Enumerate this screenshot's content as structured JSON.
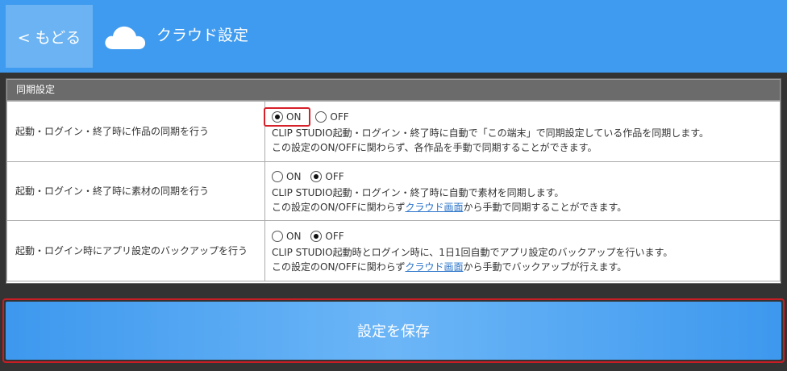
{
  "header": {
    "back_label": "< もどる",
    "title": "クラウド設定",
    "icon": "cloud-icon",
    "bg_color": "#3f9bef"
  },
  "panel": {
    "title": "同期設定",
    "rows": [
      {
        "label": "起動・ログイン・終了時に作品の同期を行う",
        "on_label": "ON",
        "off_label": "OFF",
        "selected": "ON",
        "desc_line1": "CLIP STUDIO起動・ログイン・終了時に自動で「この端末」で同期設定している作品を同期します。",
        "desc_line2": "この設定のON/OFFに関わらず、各作品を手動で同期することができます。"
      },
      {
        "label": "起動・ログイン・終了時に素材の同期を行う",
        "on_label": "ON",
        "off_label": "OFF",
        "selected": "OFF",
        "desc_line1": "CLIP STUDIO起動・ログイン・終了時に自動で素材を同期します。",
        "desc_line2_pre": "この設定のON/OFFに関わらず",
        "desc_line2_link": "クラウド画面",
        "desc_line2_post": "から手動で同期することができます。"
      },
      {
        "label": "起動・ログイン時にアプリ設定のバックアップを行う",
        "on_label": "ON",
        "off_label": "OFF",
        "selected": "OFF",
        "desc_line1": "CLIP STUDIO起動時とログイン時に、1日1回自動でアプリ設定のバックアップを行います。",
        "desc_line2_pre": "この設定のON/OFFに関わらず",
        "desc_line2_link": "クラウド画面",
        "desc_line2_post": "から手動でバックアップが行えます。"
      }
    ]
  },
  "save_label": "設定を保存"
}
